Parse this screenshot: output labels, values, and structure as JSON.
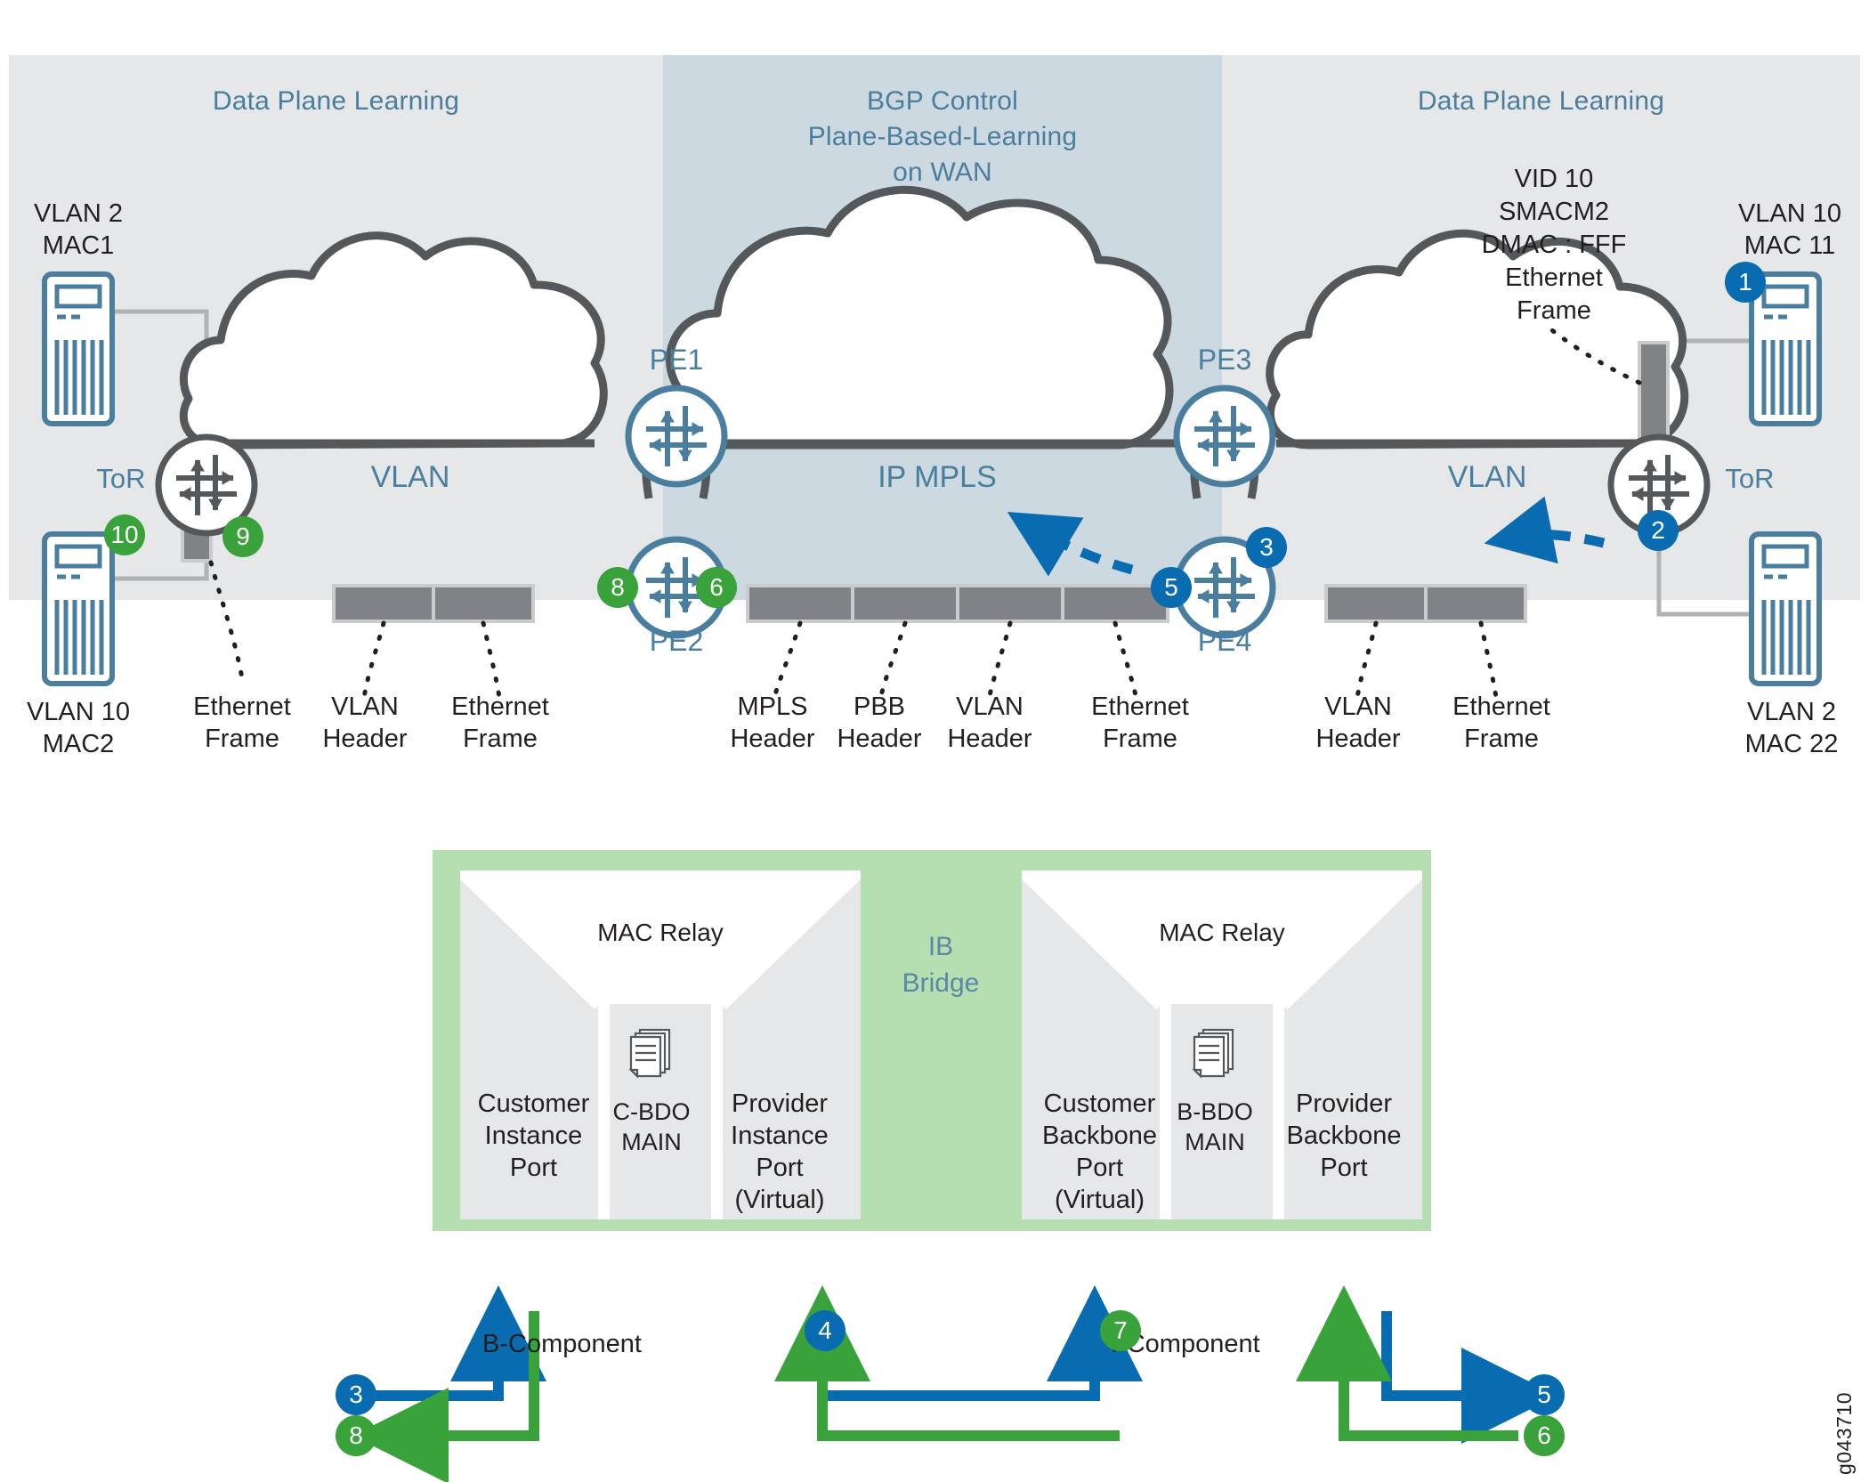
{
  "bands": {
    "left_title": "Data Plane Learning",
    "mid_title": "BGP Control\nPlane-Based-Learning\non WAN",
    "right_title": "Data Plane Learning"
  },
  "clouds": {
    "left_label": "VLAN",
    "mid_label": "IP MPLS",
    "right_label": "VLAN"
  },
  "hosts": {
    "left_top": "VLAN 2\nMAC1",
    "left_bottom": "VLAN 10\nMAC2",
    "right_top": "VLAN 10\nMAC 11",
    "right_bottom": "VLAN 2\nMAC 22"
  },
  "switches": {
    "tor_left": "ToR",
    "tor_right": "ToR",
    "pe1": "PE1",
    "pe2": "PE2",
    "pe3": "PE3",
    "pe4": "PE4"
  },
  "frame_annotation": "VID 10\nSMACM2\nDMAC : FFF\nEthernet\nFrame",
  "frame_labels": {
    "left_edge": "Ethernet\nFrame",
    "left_stack": [
      "VLAN\nHeader",
      "Ethernet\nFrame"
    ],
    "mid_stack": [
      "MPLS\nHeader",
      "PBB\nHeader",
      "VLAN\nHeader",
      "Ethernet\nFrame"
    ],
    "right_stack": [
      "VLAN\nHeader",
      "Ethernet\nFrame"
    ]
  },
  "steps": {
    "s1": "1",
    "s2": "2",
    "s3": "3",
    "s3b": "3",
    "s4": "4",
    "s5": "5",
    "s5b": "5",
    "s6": "6",
    "s6b": "6",
    "s7": "7",
    "s8": "8",
    "s8b": "8",
    "s9": "9",
    "s10": "10"
  },
  "ib": {
    "bridge_label": "IB\nBridge",
    "left": {
      "mac_relay": "MAC Relay",
      "left_port": "Customer\nInstance\nPort",
      "bdo": "C-BDO\nMAIN",
      "right_port": "Provider\nInstance\nPort\n(Virtual)",
      "component": "B-Component"
    },
    "right": {
      "mac_relay": "MAC Relay",
      "left_port": "Customer\nBackbone\nPort\n(Virtual)",
      "bdo": "B-BDO\nMAIN",
      "right_port": "Provider\nBackbone\nPort",
      "component": "I-Component"
    }
  },
  "reference_code": "g043710",
  "colors": {
    "band_gray": "#e5e7e9",
    "band_blue": "#cdd9e1",
    "accent_blue": "#0a6cb0",
    "accent_green": "#3aa23a",
    "label_blue": "#4a7e9e",
    "panel_green": "#b5dfb0",
    "frame_gray": "#808285",
    "cloud_stroke": "#54585a",
    "device_blue": "#4a7e9e"
  }
}
